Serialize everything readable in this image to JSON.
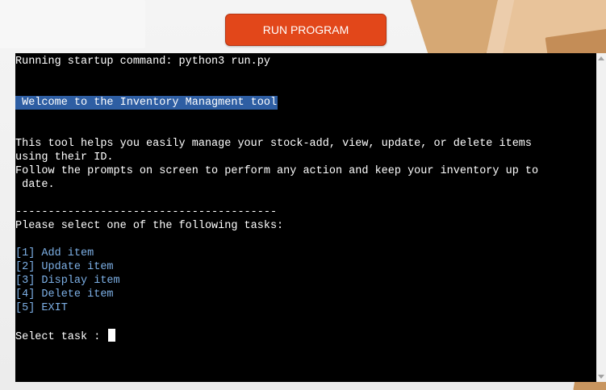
{
  "header": {
    "run_button_label": "RUN PROGRAM"
  },
  "terminal": {
    "startup_line": "Running startup command: python3 run.py",
    "welcome_banner": " Welcome to the Inventory Managment tool",
    "intro_lines": [
      "This tool helps you easily manage your stock-add, view, update, or delete items",
      "using their ID.",
      "Follow the prompts on screen to perform any action and keep your inventory up to",
      " date."
    ],
    "separator": "----------------------------------------",
    "prompt_heading": "Please select one of the following tasks:",
    "menu_items": [
      "[1] Add item",
      "[2] Update item",
      "[3] Display item",
      "[4] Delete item",
      "[5] EXIT"
    ],
    "input_prompt": "Select task : "
  },
  "colors": {
    "run_button": "#e2471a",
    "terminal_background": "#000000",
    "terminal_text": "#ffffff",
    "welcome_highlight": "#2e5ea3",
    "menu_text": "#7db0e6"
  }
}
